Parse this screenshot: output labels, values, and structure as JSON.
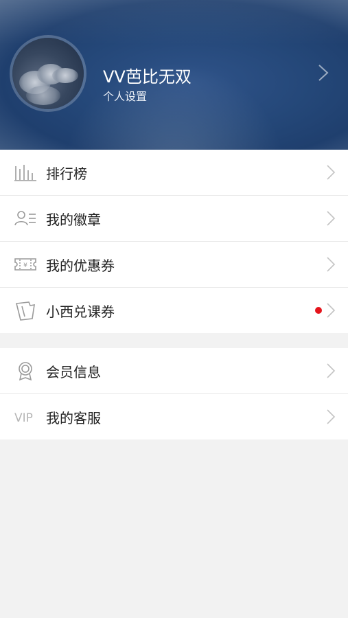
{
  "profile": {
    "username": "VV芭比无双",
    "settings_label": "个人设置"
  },
  "menu_group_1": [
    {
      "label": "排行榜",
      "icon": "bar-chart-icon"
    },
    {
      "label": "我的徽章",
      "icon": "user-list-icon"
    },
    {
      "label": "我的优惠券",
      "icon": "coupon-icon"
    },
    {
      "label": "小西兑课券",
      "icon": "ticket-icon",
      "badge": "red-dot"
    }
  ],
  "menu_group_2": [
    {
      "label": "会员信息",
      "icon": "medal-icon"
    },
    {
      "label": "我的客服",
      "icon": "vip-icon",
      "icon_text": "VIP"
    }
  ],
  "colors": {
    "header_blue": "#244778",
    "badge_red": "#e5141b",
    "background": "#f2f2f2"
  }
}
